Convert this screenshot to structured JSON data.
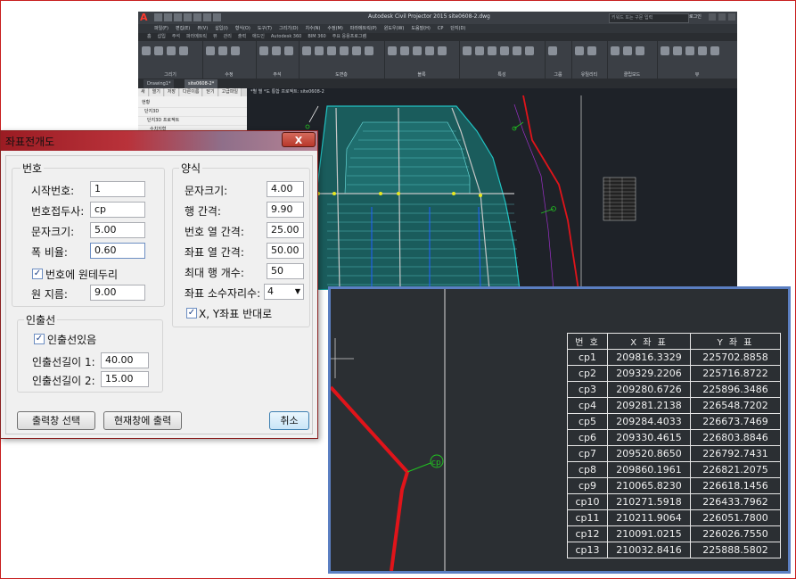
{
  "cad": {
    "title_text": "Autodesk Civil Projector 2015    site0608-2.dwg",
    "search_placeholder": "키워드 또는 구문 입력",
    "user": "로그인",
    "menu": [
      "파일(F)",
      "편집(E)",
      "뷰(V)",
      "삽입(I)",
      "형식(O)",
      "도구(T)",
      "그리기(D)",
      "치수(N)",
      "수정(M)",
      "파라메트릭(P)",
      "윈도우(W)",
      "도움말(H)",
      "CP",
      "단지(D)"
    ],
    "ribbon_tabs": [
      "홈",
      "삽입",
      "주석",
      "파라메트릭",
      "뷰",
      "관리",
      "출력",
      "애드인",
      "Autodesk 360",
      "BIM 360",
      "주요 응용프로그램"
    ],
    "ribbon_groups": [
      "그리기",
      "수정",
      "주석",
      "도면층",
      "블록",
      "특성",
      "그룹",
      "유틸리티",
      "클립보드",
      "뷰"
    ],
    "doc_tabs": [
      "Drawing1*",
      "site0608-2*"
    ],
    "panel_tabs": [
      "새",
      "열기",
      "저장",
      "다른이름",
      "닫기",
      "고급파일"
    ],
    "panel_tree": [
      "현황",
      "단지3D",
      "단지3D 프로젝트",
      "수치지형"
    ],
    "path_text": "*별  별  *도    통합 프로젝트: site0608-2"
  },
  "coord_table": {
    "headers": [
      "번 호",
      "X 좌 표",
      "Y 좌 표"
    ],
    "rows": [
      [
        "cp1",
        "209816.3329",
        "225702.8858"
      ],
      [
        "cp2",
        "209329.2206",
        "225716.8722"
      ],
      [
        "cp3",
        "209280.6726",
        "225896.3486"
      ],
      [
        "cp4",
        "209281.2138",
        "226548.7202"
      ],
      [
        "cp5",
        "209284.4033",
        "226673.7469"
      ],
      [
        "cp6",
        "209330.4615",
        "226803.8846"
      ],
      [
        "cp7",
        "209520.8650",
        "226792.7431"
      ],
      [
        "cp8",
        "209860.1961",
        "226821.2075"
      ],
      [
        "cp9",
        "210065.8230",
        "226618.1456"
      ],
      [
        "cp10",
        "210271.5918",
        "226433.7962"
      ],
      [
        "cp11",
        "210211.9064",
        "226051.7800"
      ],
      [
        "cp12",
        "210091.0215",
        "226026.7550"
      ],
      [
        "cp13",
        "210032.8416",
        "225888.5802"
      ]
    ],
    "marker_label": "cp"
  },
  "dialog": {
    "title": "좌표전개도",
    "close_label": "X",
    "numbering": {
      "title": "번호",
      "start_label": "시작번호:",
      "start_value": "1",
      "prefix_label": "번호접두사:",
      "prefix_value": "cp",
      "text_size_label": "문자크기:",
      "text_size_value": "5.00",
      "width_ratio_label": "폭 비율:",
      "width_ratio_value": "0.60",
      "circle_border_label": "번호에 원테두리",
      "circle_border_checked": true,
      "circle_diameter_label": "원 지름:",
      "circle_diameter_value": "9.00"
    },
    "leader": {
      "title": "인출선",
      "has_leader_label": "인출선있음",
      "has_leader_checked": true,
      "length1_label": "인출선길이 1:",
      "length1_value": "40.00",
      "length2_label": "인출선길이 2:",
      "length2_value": "15.00"
    },
    "style": {
      "title": "양식",
      "text_size_label": "문자크기:",
      "text_size_value": "4.00",
      "row_gap_label": "행 간격:",
      "row_gap_value": "9.90",
      "number_col_gap_label": "번호 열 간격:",
      "number_col_gap_value": "25.00",
      "coord_col_gap_label": "좌표 열 간격:",
      "coord_col_gap_value": "50.00",
      "max_rows_label": "최대 행 개수:",
      "max_rows_value": "50",
      "decimals_label": "좌표 소수자리수:",
      "decimals_value": "4",
      "swap_xy_label": "X, Y좌표 반대로",
      "swap_xy_checked": true
    },
    "buttons": {
      "select_output": "출력창 선택",
      "print_current": "현재창에 출력",
      "cancel": "취소"
    }
  },
  "colors": {
    "cad_background": "#1e2228",
    "zoom_border": "#5b7fc2",
    "boundary_red": "#e0141a",
    "marker_green": "#21c321",
    "dialog_title_red": "#9b1c23"
  }
}
